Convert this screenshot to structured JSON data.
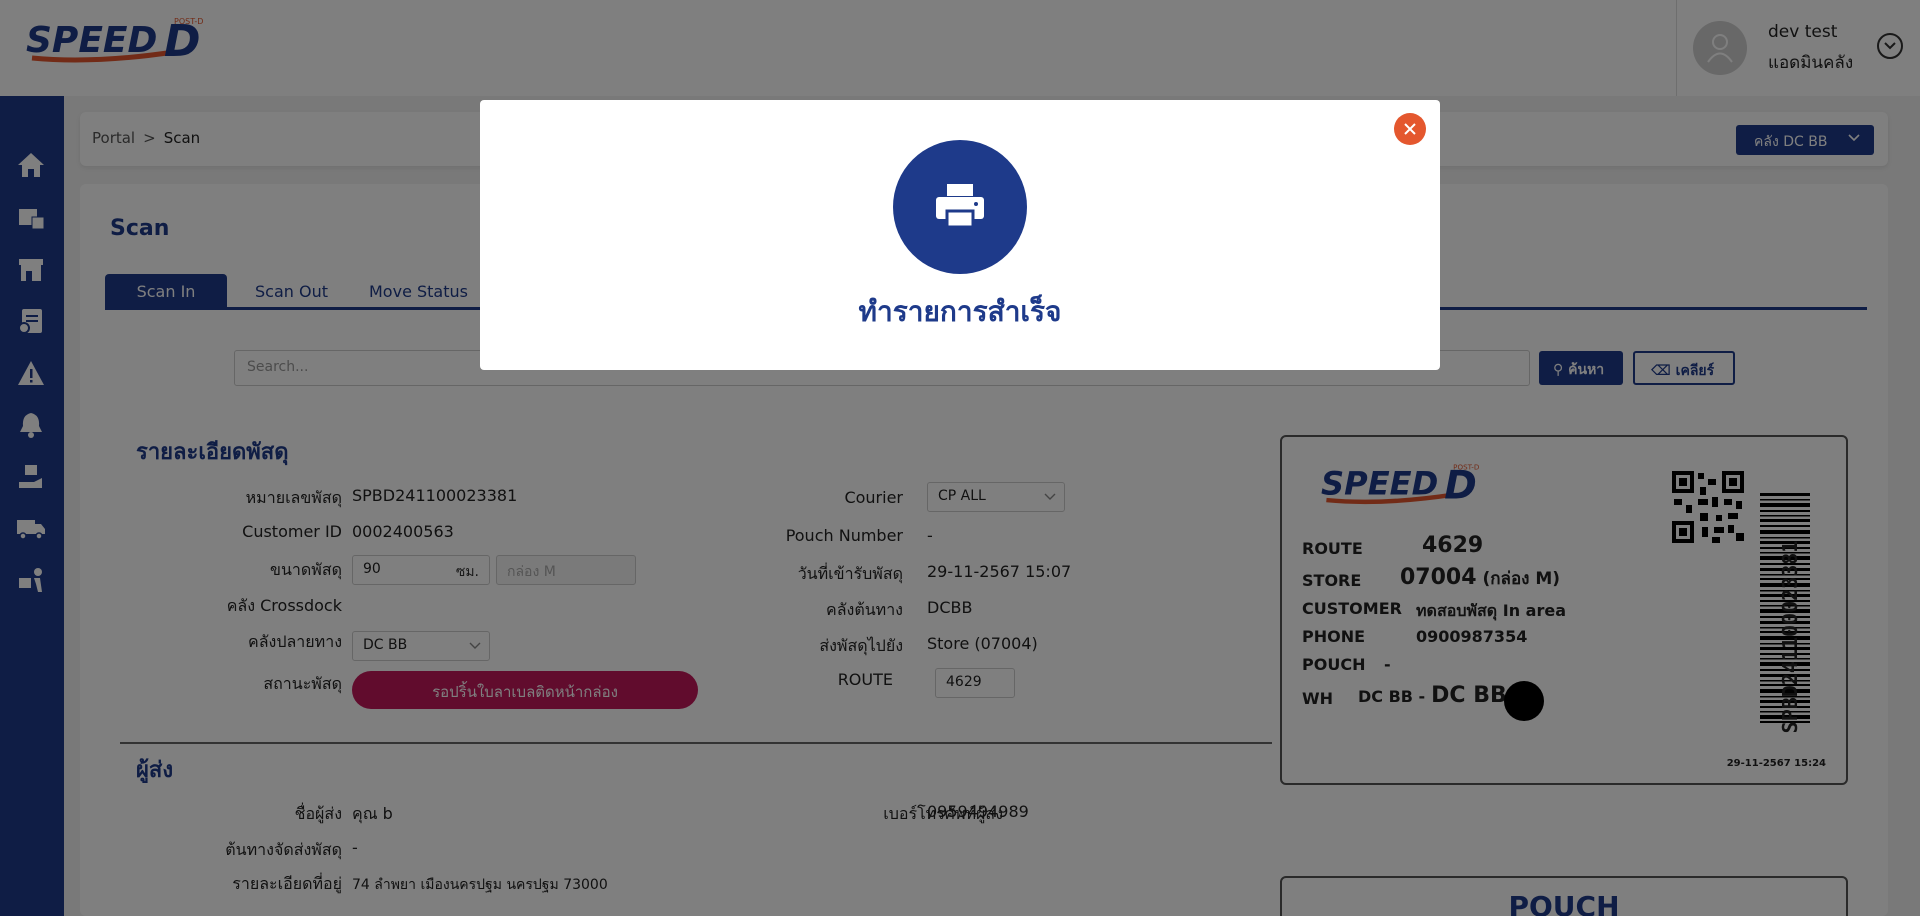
{
  "brand": {
    "logo_text": "SPEED-D",
    "logo_sub": "POST-D",
    "primary": "#1e3a8a",
    "accent": "#e4572e",
    "status_pink": "#c2185b"
  },
  "user": {
    "name": "dev test",
    "role": "แอดมินคลัง"
  },
  "sidebar": {
    "items": [
      {
        "icon": "home-icon"
      },
      {
        "icon": "parcels-icon"
      },
      {
        "icon": "store-icon"
      },
      {
        "icon": "document-icon"
      },
      {
        "icon": "warning-icon"
      },
      {
        "icon": "bell-icon"
      },
      {
        "icon": "parcel-hand-icon"
      },
      {
        "icon": "truck-icon"
      },
      {
        "icon": "delivery-person-icon"
      }
    ]
  },
  "breadcrumb": {
    "root": "Portal",
    "separator": ">",
    "current": "Scan"
  },
  "warehouse_select": {
    "value": "คลัง DC BB"
  },
  "page": {
    "title": "Scan"
  },
  "tabs": [
    {
      "label": "Scan In",
      "active": true
    },
    {
      "label": "Scan Out",
      "active": false
    },
    {
      "label": "Move Status",
      "active": false
    }
  ],
  "search": {
    "placeholder": "Search...",
    "search_label": "ค้นหา",
    "clear_label": "เคลียร์"
  },
  "parcel": {
    "section_title": "รายละเอียดพัสดุ",
    "tracking_label": "หมายเลขพัสดุ",
    "tracking": "SPBD241100023381",
    "customer_id_label": "Customer ID",
    "customer_id": "0002400563",
    "size_label": "ขนาดพัสดุ",
    "size_value": "90",
    "size_unit": "ซม.",
    "box_size": "กล่อง M",
    "crossdock_label": "คลัง Crossdock",
    "crossdock": "",
    "dest_wh_label": "คลังปลายทาง",
    "dest_wh": "DC BB",
    "status_label": "สถานะพัสดุ",
    "status": "รอปริ้นใบลาเบลติดหน้ากล่อง",
    "courier_label": "Courier",
    "courier": "CP ALL",
    "pouch_label": "Pouch Number",
    "pouch": "-",
    "received_label": "วันที่เข้ารับพัสดุ",
    "received": "29-11-2567 15:07",
    "origin_wh_label": "คลังต้นทาง",
    "origin_wh": "DCBB",
    "send_to_label": "ส่งพัสดุไปยัง",
    "send_to": "Store (07004)",
    "route_label": "ROUTE",
    "route": "4629"
  },
  "sender": {
    "section_title": "ผู้ส่ง",
    "name_label": "ชื่อผู้ส่ง",
    "name": "คุณ b",
    "origin_label": "ต้นทางจัดส่งพัสดุ",
    "origin": "-",
    "address_label": "รายละเอียดที่อยู่",
    "address": "74 ลำพยา เมืองนครปฐม นครปฐม 73000",
    "phone_label": "เบอร์โทรศัพท์ผู้ส่ง",
    "phone": "0959494989"
  },
  "label_preview": {
    "route_key": "ROUTE",
    "route": "4629",
    "store_key": "STORE",
    "store": "07004",
    "store_box": "(กล่อง M)",
    "customer_key": "CUSTOMER",
    "customer": "ทดสอบพัสดุ In area",
    "phone_key": "PHONE",
    "phone": "0900987354",
    "pouch_key": "POUCH",
    "pouch": "-",
    "wh_key": "WH",
    "wh_small": "DC BB -",
    "wh_big": "DC BB",
    "barcode": "SPBD241100023381",
    "date": "29-11-2567 15:24"
  },
  "pouch_card": {
    "title": "POUCH"
  },
  "modal": {
    "message": "ทำรายการสำเร็จ",
    "icon": "printer-icon"
  }
}
